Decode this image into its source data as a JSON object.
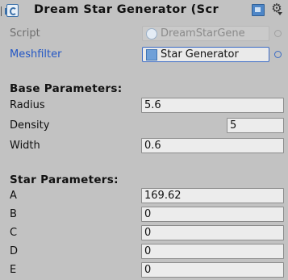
{
  "component": {
    "title": "Dream Star Generator (Scr"
  },
  "fields": {
    "script": {
      "label": "Script",
      "value": "DreamStarGene"
    },
    "meshfilter": {
      "label": "Meshfilter",
      "value": "Star Generator"
    }
  },
  "base_parameters": {
    "heading": "Base Parameters:",
    "radius": {
      "label": "Radius",
      "value": "5.6"
    },
    "density": {
      "label": "Density",
      "value": "5",
      "slider_fraction": 0.0
    },
    "width": {
      "label": "Width",
      "value": "0.6"
    }
  },
  "star_parameters": {
    "heading": "Star Parameters:",
    "a": {
      "label": "A",
      "value": "169.62"
    },
    "b": {
      "label": "B",
      "value": "0"
    },
    "c": {
      "label": "C",
      "value": "0"
    },
    "d": {
      "label": "D",
      "value": "0"
    },
    "e": {
      "label": "E",
      "value": "0"
    }
  },
  "icons": {
    "component": "script-icon",
    "help": "help-book-icon",
    "settings": "gear-icon"
  },
  "colors": {
    "background": "#c2c2c2",
    "link_label": "#2457c4",
    "field_bg": "#ececec",
    "focus_border": "#3b6bc4"
  }
}
